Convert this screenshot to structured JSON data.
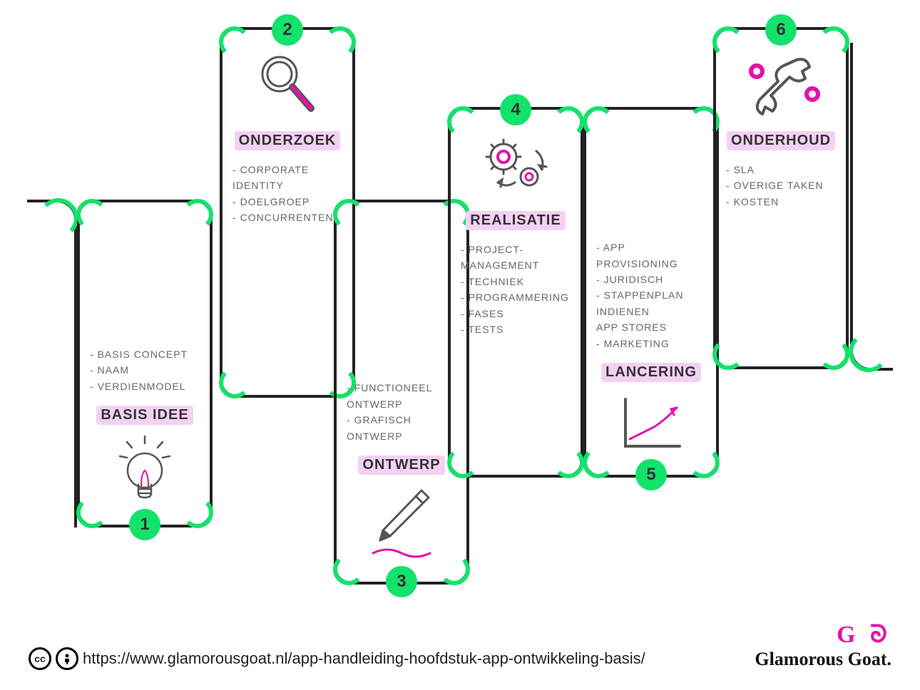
{
  "steps": [
    {
      "num": "1",
      "title": "BASIS IDEE",
      "items": [
        "BASIS CONCEPT",
        "NAAM",
        "VERDIENMODEL"
      ]
    },
    {
      "num": "2",
      "title": "ONDERZOEK",
      "items": [
        "CORPORATE\nIDENTITY",
        "DOELGROEP",
        "CONCURRENTEN"
      ]
    },
    {
      "num": "3",
      "title": "ONTWERP",
      "items": [
        "FUNCTIONEEL\nONTWERP",
        "GRAFISCH\nONTWERP"
      ]
    },
    {
      "num": "4",
      "title": "REALISATIE",
      "items": [
        "PROJECT-\nMANAGEMENT",
        "TECHNIEK",
        "PROGRAMMERING",
        "FASES",
        "TESTS"
      ]
    },
    {
      "num": "5",
      "title": "LANCERING",
      "items": [
        "APP\nPROVISIONING",
        "JURIDISCH",
        "STAPPENPLAN\nINDIENEN\nAPP STORES",
        "MARKETING"
      ]
    },
    {
      "num": "6",
      "title": "ONDERHOUD",
      "items": [
        "SLA",
        "OVERIGE TAKEN",
        "KOSTEN"
      ]
    }
  ],
  "footer": {
    "cc": "cc",
    "by": "🄯",
    "url": "https://www.glamorousgoat.nl/app-handleiding-hoofdstuk-app-ontwikkeling-basis/",
    "brand_icon": "G ᘐ",
    "brand_name": "Glamorous Goat."
  }
}
